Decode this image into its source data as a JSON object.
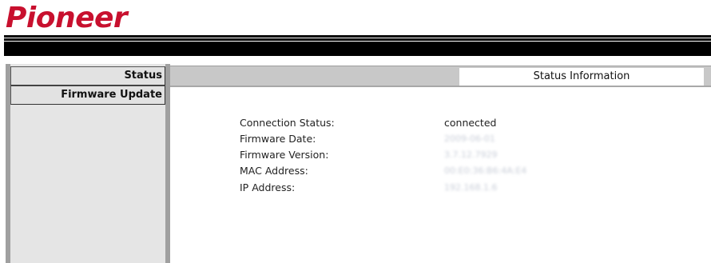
{
  "brand": {
    "logo_text": "Pioneer"
  },
  "sidebar": {
    "items": [
      {
        "label": "Status"
      },
      {
        "label": "Firmware Update"
      }
    ]
  },
  "header": {
    "active_tab": "Status Information"
  },
  "status": {
    "rows": [
      {
        "label": "Connection Status:",
        "value": "connected"
      },
      {
        "label": "Firmware Date:",
        "value": "2009-06-01"
      },
      {
        "label": "Firmware Version:",
        "value": "3.7.12.7929"
      },
      {
        "label": "MAC Address:",
        "value": "00:E0:36:B6:4A:E4"
      },
      {
        "label": "IP Address:",
        "value": "192.168.1.6"
      }
    ]
  },
  "colors": {
    "brand": "#c8102e",
    "sidebar_frame": "#a0a0a0",
    "nav_button": "#e2e2e2",
    "header_bar": "#c8c8c8"
  }
}
